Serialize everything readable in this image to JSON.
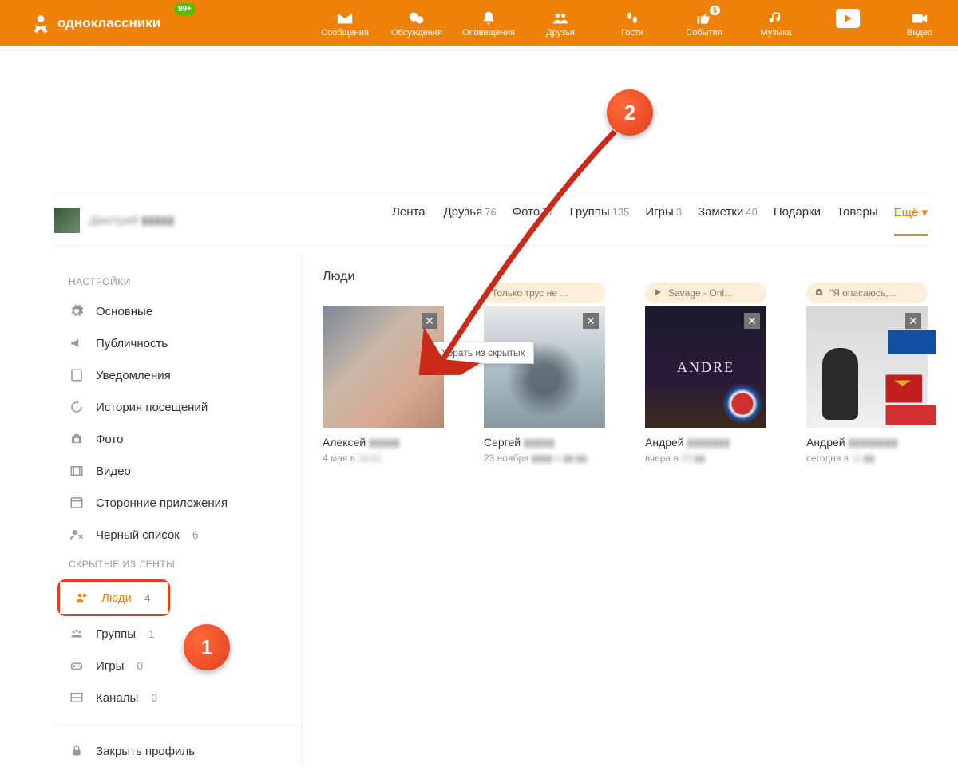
{
  "topbar": {
    "brand": "одноклассники",
    "badge": "99+",
    "nav": [
      {
        "label": "Сообщения"
      },
      {
        "label": "Обсуждения"
      },
      {
        "label": "Оповещения"
      },
      {
        "label": "Друзья"
      },
      {
        "label": "Гости"
      },
      {
        "label": "События",
        "badge": "5"
      },
      {
        "label": "Музыка"
      },
      {
        "label": ""
      },
      {
        "label": "Видео"
      }
    ]
  },
  "profile": {
    "name": "Дмитрий ▮▮▮▮▮"
  },
  "tabs": [
    {
      "label": "Лента",
      "count": ""
    },
    {
      "label": "Друзья",
      "count": "76"
    },
    {
      "label": "Фото",
      "count": "77"
    },
    {
      "label": "Группы",
      "count": "135"
    },
    {
      "label": "Игры",
      "count": "3"
    },
    {
      "label": "Заметки",
      "count": "40"
    },
    {
      "label": "Подарки",
      "count": ""
    },
    {
      "label": "Товары",
      "count": ""
    },
    {
      "label": "Ещё ▾",
      "count": ""
    }
  ],
  "active_tab_index": 8,
  "sidebar": {
    "settings_header": "НАСТРОЙКИ",
    "settings": [
      {
        "label": "Основные"
      },
      {
        "label": "Публичность"
      },
      {
        "label": "Уведомления"
      },
      {
        "label": "История посещений"
      },
      {
        "label": "Фото"
      },
      {
        "label": "Видео"
      },
      {
        "label": "Сторонние приложения"
      },
      {
        "label": "Черный список",
        "count": "6"
      }
    ],
    "hidden_header": "СКРЫТЫЕ ИЗ ЛЕНТЫ",
    "hidden": [
      {
        "label": "Люди",
        "count": "4"
      },
      {
        "label": "Группы",
        "count": "1"
      },
      {
        "label": "Игры",
        "count": "0"
      },
      {
        "label": "Каналы",
        "count": "0"
      }
    ],
    "lock": "Закрыть профиль"
  },
  "main": {
    "title": "Люди",
    "tooltip": "Убрать из скрытых",
    "people": [
      {
        "name_first": "Алексей",
        "name_rest": "▮▮▮▮▮",
        "date_first": "4 мая в",
        "date_rest": "16:51",
        "badge": null
      },
      {
        "name_first": "Сергей",
        "name_rest": "▮▮▮▮▮",
        "date_first": "23 ноября",
        "date_rest": "▮▮▮▮ в ▮▮:▮▮",
        "badge": {
          "type": "text",
          "text": "Только трус не ..."
        }
      },
      {
        "name_first": "Андрей",
        "name_rest": "▮▮▮▮▮▮▮",
        "date_first": "вчера в",
        "date_rest": "20:▮▮",
        "badge": {
          "type": "play",
          "text": "Savage - Onl..."
        }
      },
      {
        "name_first": "Андрей",
        "name_rest": "▮▮▮▮▮▮▮▮",
        "date_first": "сегодня в",
        "date_rest": "11:▮▮",
        "badge": {
          "type": "camera",
          "text": "\"Я опасаюсь,..."
        }
      }
    ]
  },
  "callouts": {
    "one": "1",
    "two": "2"
  }
}
